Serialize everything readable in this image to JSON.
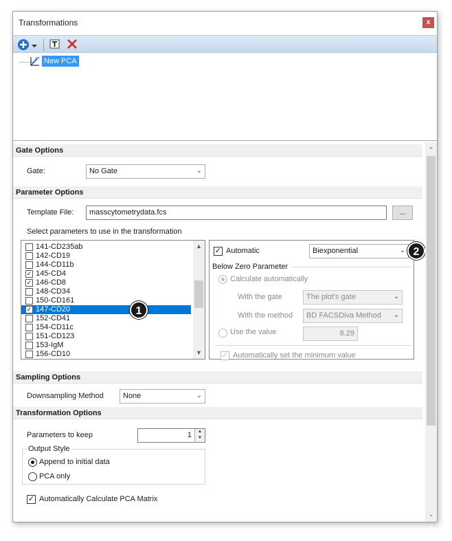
{
  "window": {
    "title": "Transformations",
    "close_glyph": "x"
  },
  "toolbar": {
    "add_icon": "plus-circle-icon",
    "dropdown_icon": "chevron-down-icon",
    "template_icon": "text-template-icon",
    "delete_icon": "red-x-icon"
  },
  "tree": {
    "item_label": "New PCA",
    "item_icon": "pca-icon"
  },
  "gate_options": {
    "header": "Gate Options",
    "gate_label": "Gate:",
    "gate_value": "No Gate"
  },
  "parameter_options": {
    "header": "Parameter Options",
    "template_label": "Template File:",
    "template_value": "masscytometrydata.fcs",
    "browse_label": "...",
    "select_label": "Select parameters to use in the transformation",
    "items": [
      {
        "label": "141-CD235ab",
        "checked": false
      },
      {
        "label": "142-CD19",
        "checked": false
      },
      {
        "label": "144-CD11b",
        "checked": false
      },
      {
        "label": "145-CD4",
        "checked": true
      },
      {
        "label": "146-CD8",
        "checked": true
      },
      {
        "label": "148-CD34",
        "checked": false
      },
      {
        "label": "150-CD161",
        "checked": false
      },
      {
        "label": "147-CD20",
        "checked": true
      },
      {
        "label": "152-CD41",
        "checked": false
      },
      {
        "label": "154-CD11c",
        "checked": false
      },
      {
        "label": "151-CD123",
        "checked": false
      },
      {
        "label": "153-IgM",
        "checked": false
      },
      {
        "label": "156-CD10",
        "checked": false
      }
    ],
    "badge1": "1",
    "badge2": "2",
    "automatic_label": "Automatic",
    "transform_type": "Biexponential",
    "below_zero_label": "Below Zero Parameter",
    "calc_auto_label": "Calculate automatically",
    "with_gate_label": "With the gate",
    "gate_choice": "The plot's gate",
    "with_method_label": "With the method",
    "method_choice": "BD FACSDiva Method",
    "use_value_label": "Use the value",
    "value": "8.29",
    "auto_min_label": "Automatically set the minimum value"
  },
  "sampling_options": {
    "header": "Sampling Options",
    "method_label": "Downsampling Method",
    "method_value": "None"
  },
  "transformation_options": {
    "header": "Transformation Options",
    "params_keep_label": "Parameters to keep",
    "params_keep_value": "1",
    "output_style_label": "Output Style",
    "append_label": "Append to initial data",
    "pca_only_label": "PCA only",
    "auto_calc_label": "Automatically Calculate PCA Matrix"
  }
}
